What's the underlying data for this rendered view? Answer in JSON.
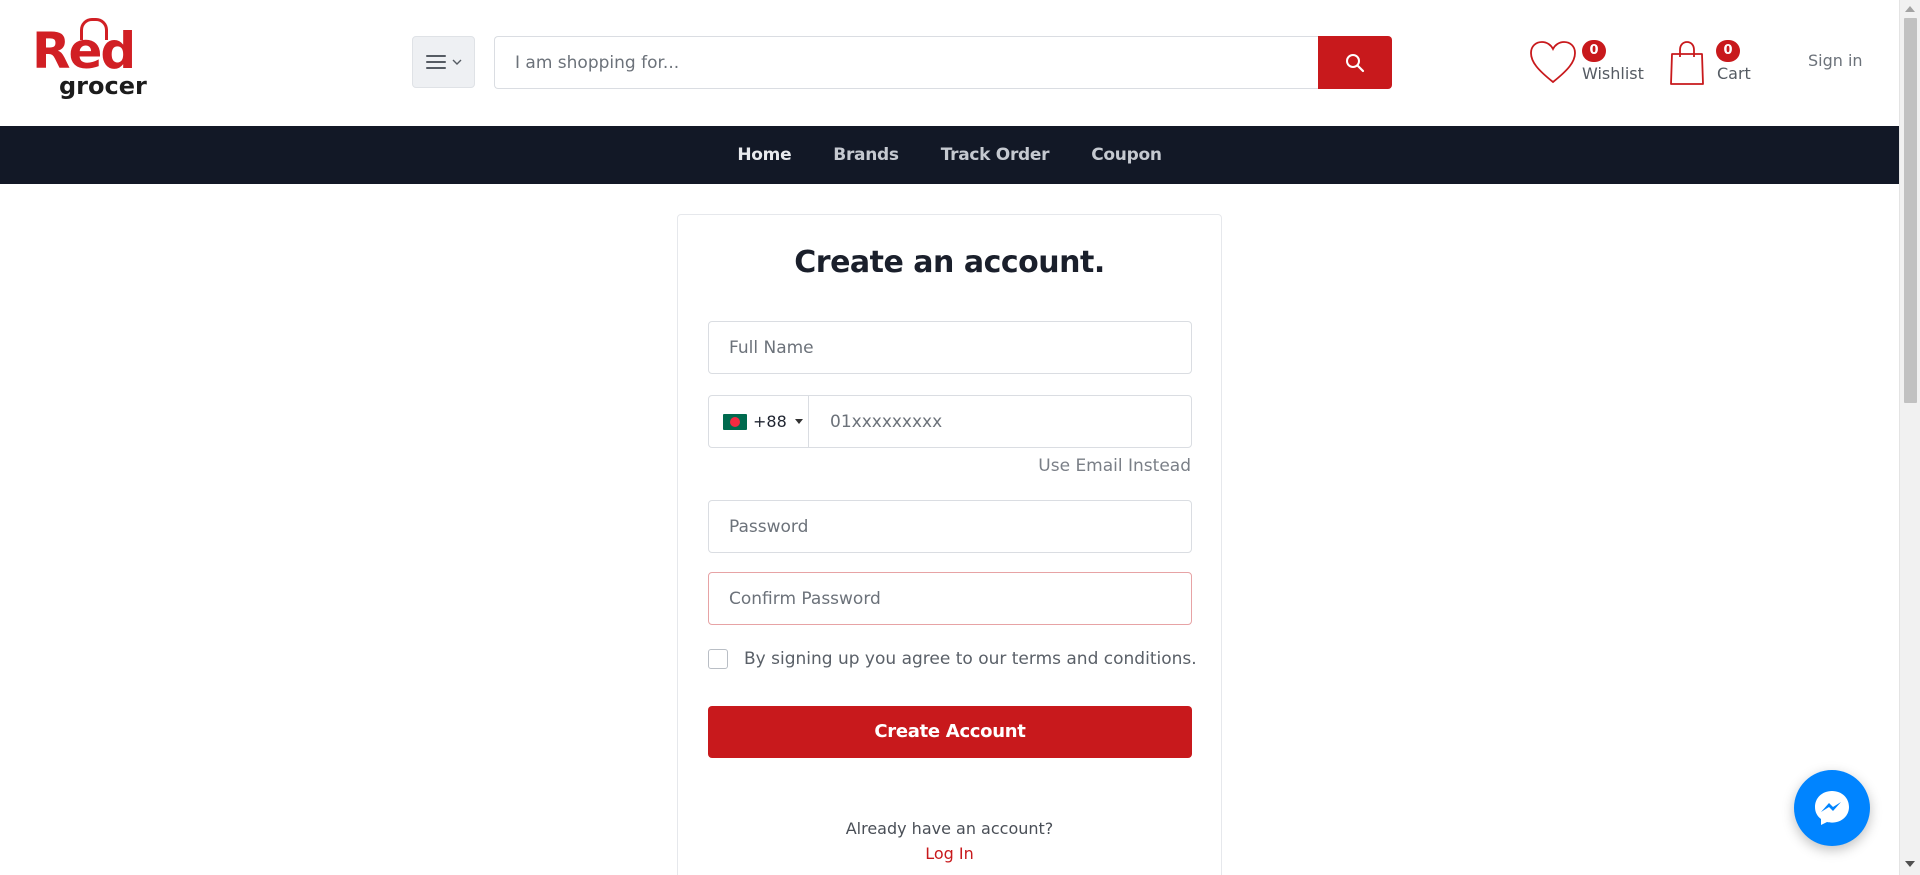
{
  "brand": {
    "logo_top": "Red",
    "logo_bottom": "grocer",
    "accent": "#c8191c",
    "nav_bg": "#121826"
  },
  "header": {
    "menu_icon": "hamburger-icon",
    "search": {
      "placeholder": "I am shopping for...",
      "value": "",
      "button_icon": "search-icon"
    },
    "wishlist": {
      "label": "Wishlist",
      "count": "0",
      "icon": "heart-icon"
    },
    "cart": {
      "label": "Cart",
      "count": "0",
      "icon": "shopping-bag-icon"
    },
    "signin_label": "Sign in"
  },
  "nav": {
    "items": [
      "Home",
      "Brands",
      "Track Order",
      "Coupon"
    ]
  },
  "form": {
    "title": "Create an account.",
    "full_name_placeholder": "Full Name",
    "country_code": "+88",
    "country_flag": "bangladesh-flag-icon",
    "phone_placeholder": "01xxxxxxxxx",
    "use_email_label": "Use Email Instead",
    "password_placeholder": "Password",
    "confirm_password_placeholder": "Confirm Password",
    "terms_text": "By signing up you agree to our terms and conditions.",
    "terms_checked": false,
    "submit_label": "Create Account",
    "already_text": "Already have an account?",
    "login_label": "Log In"
  },
  "chat": {
    "icon": "messenger-icon",
    "color": "#0084ff"
  }
}
